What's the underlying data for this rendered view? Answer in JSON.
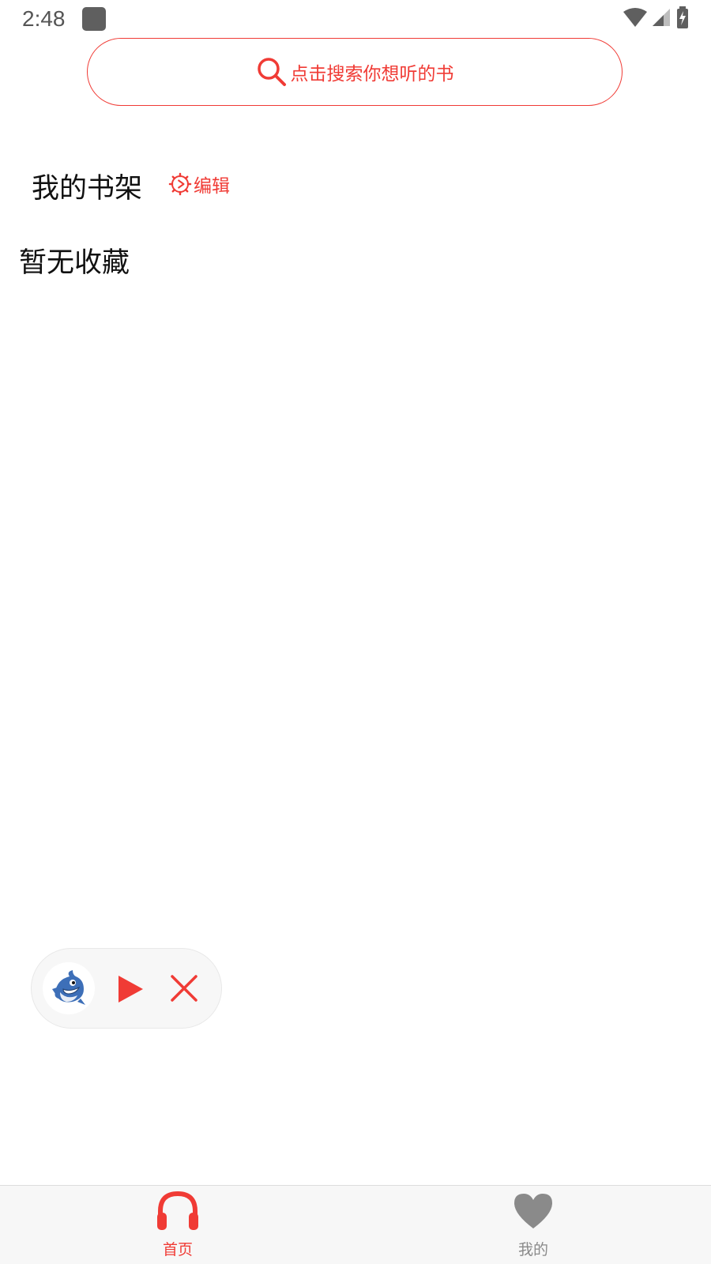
{
  "status_bar": {
    "time": "2:48",
    "icon_color": "#5f5f5f"
  },
  "search": {
    "placeholder": "点击搜索你想听的书",
    "icon": "search-icon",
    "accent_color": "#f03b35"
  },
  "shelf": {
    "title": "我的书架",
    "edit_label": "编辑",
    "edit_icon": "gear-icon",
    "empty_text": "暂无收藏"
  },
  "mini_player": {
    "cover_icon": "shark-mascot",
    "play_icon": "play-icon",
    "close_icon": "close-icon"
  },
  "bottom_nav": {
    "items": [
      {
        "label": "首页",
        "icon": "headphones-icon",
        "active": true,
        "color": "#f03b35"
      },
      {
        "label": "我的",
        "icon": "heart-icon",
        "active": false,
        "color": "#8a8a8a"
      }
    ]
  }
}
